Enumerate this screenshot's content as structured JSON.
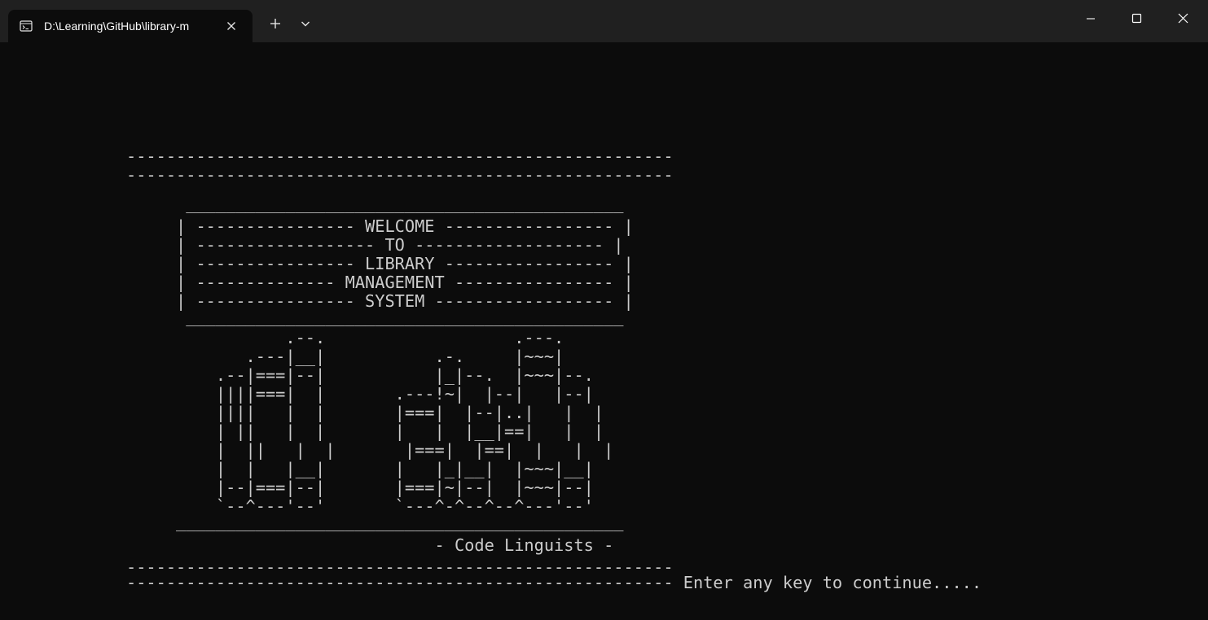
{
  "window": {
    "tab_title": "D:\\Learning\\GitHub\\library-m",
    "icons": {
      "tab": "terminal-icon",
      "tab_close": "close-icon",
      "new_tab": "plus-icon",
      "dropdown": "chevron-down-icon",
      "minimize": "minimize-icon",
      "maximize": "maximize-icon",
      "close": "close-icon"
    }
  },
  "terminal": {
    "colors": {
      "background": "#0c0c0c",
      "foreground": "#cccccc"
    },
    "lines": [
      "-------------------------------------------------------",
      "-------------------------------------------------------",
      "      ____________________________________________",
      "     | ---------------- WELCOME ----------------- |",
      "     | ------------------ TO ------------------- |",
      "     | ---------------- LIBRARY ----------------- |",
      "     | -------------- MANAGEMENT ---------------- |",
      "     | ---------------- SYSTEM ------------------ |",
      "      ____________________________________________",
      "                .--.                   .---.",
      "            .---|__|           .-.     |~~~|",
      "         .--|===|--|           |_|--.  |~~~|--.",
      "         ||||===|  |       .---!~|  |--|   |--|",
      "         ||||   |  |       |===|  |--|..|   |  |",
      "         | ||   |  |       |   |  |__|==|   |  |",
      "         |  ||   |  |       |===|  |==|  |   |  |",
      "         |  |   |__|       |   |_|__|  |~~~|__|",
      "         |--|===|--|       |===|~|--|  |~~~|--|",
      "         `--^---'--'       `---^-^--^--^---'--'",
      "     _____________________________________________",
      "                               - Code Linguists -",
      "-------------------------------------------------------",
      "------------------------------------------------------- Enter any key to continue....."
    ]
  }
}
